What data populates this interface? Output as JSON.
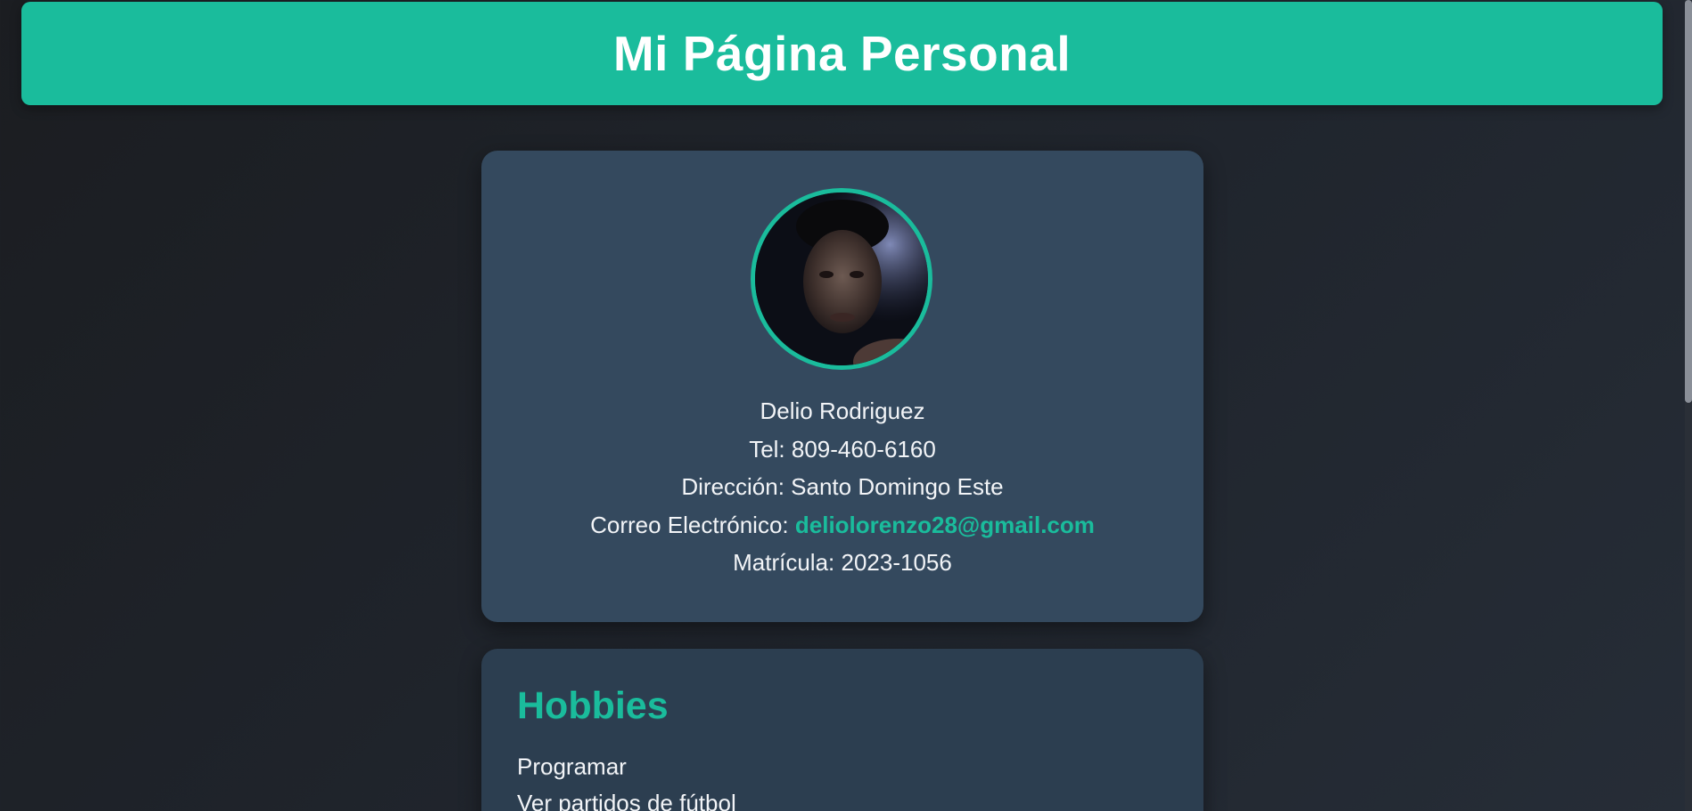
{
  "header": {
    "title": "Mi Página Personal"
  },
  "profile": {
    "avatar_alt": "Foto de perfil",
    "name": "Delio Rodriguez",
    "phone_label": "Tel:",
    "phone": "809-460-6160",
    "address_label": "Dirección:",
    "address": "Santo Domingo Este",
    "email_label": "Correo Electrónico:",
    "email": "deliolorenzo28@gmail.com",
    "id_label": "Matrícula:",
    "id": "2023-1056"
  },
  "hobbies": {
    "title": "Hobbies",
    "items": [
      "Programar",
      "Ver partidos de fútbol"
    ]
  },
  "colors": {
    "accent": "#1abc9c",
    "card": "#34495e",
    "card_dark": "#2c3e50",
    "background": "#1f2329"
  }
}
